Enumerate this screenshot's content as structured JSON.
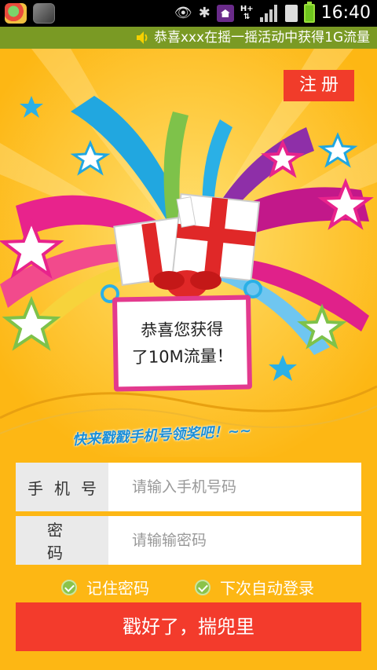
{
  "status_bar": {
    "time": "16:40",
    "network": "H+"
  },
  "marquee": {
    "text": "恭喜xxx在摇一摇活动中获得1G流量"
  },
  "header": {
    "register_label": "注册"
  },
  "illustration": {
    "sign_line1": "恭喜您获得",
    "sign_line2": "了10M流量！",
    "slogan": "快来戳戳手机号领奖吧！~~"
  },
  "form": {
    "phone_label": "手机号",
    "phone_placeholder": "请输入手机号码",
    "password_label": "密码",
    "password_placeholder": "请输输密码",
    "remember_label": "记住密码",
    "auto_login_label": "下次自动登录",
    "submit_label": "戳好了，揣兜里"
  },
  "colors": {
    "background": "#FDB714",
    "accent_red": "#F13C2A",
    "marquee_bg": "#7A9A24",
    "check_green": "#8BC34A"
  }
}
